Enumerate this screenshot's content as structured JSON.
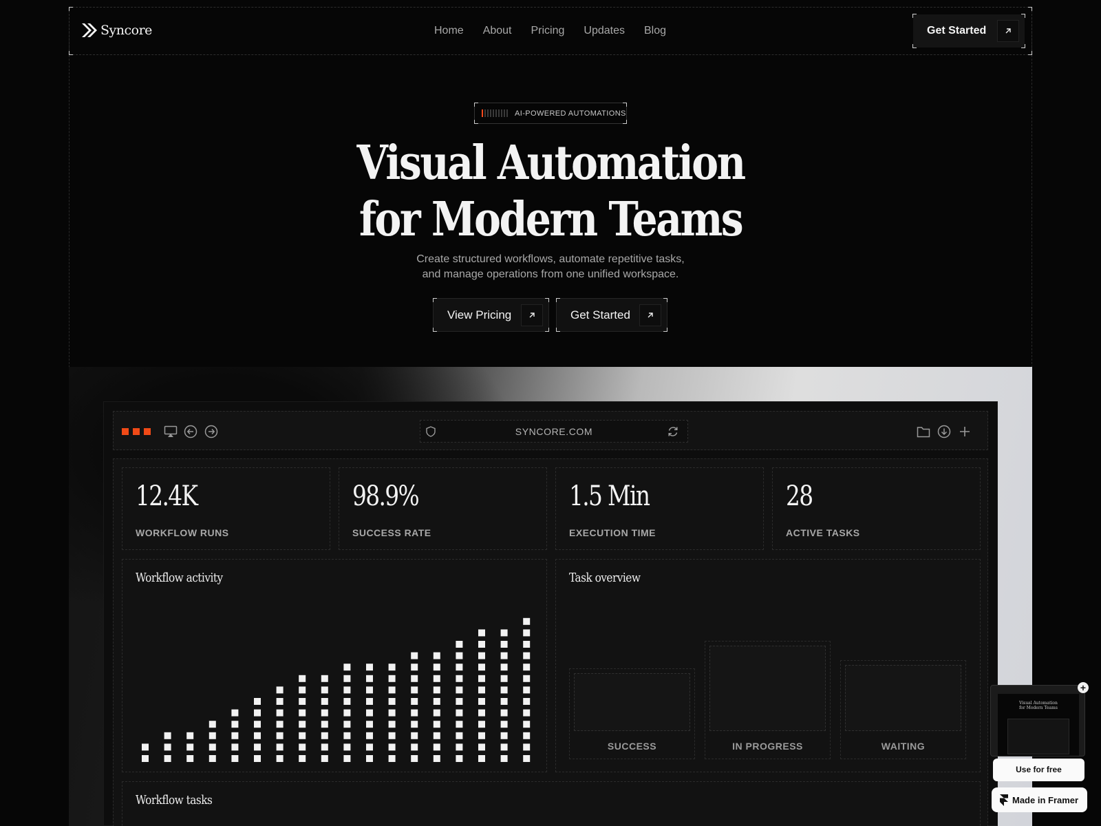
{
  "brand": {
    "name": "Syncore"
  },
  "nav": {
    "links": [
      "Home",
      "About",
      "Pricing",
      "Updates",
      "Blog"
    ],
    "cta_label": "Get Started"
  },
  "hero": {
    "badge": "AI-POWERED AUTOMATIONS",
    "title_line1": "Visual Automation",
    "title_line2": "for Modern Teams",
    "subtitle_line1": "Create structured workflows, automate repetitive tasks,",
    "subtitle_line2": "and manage operations from one unified workspace.",
    "primary_button": "View Pricing",
    "secondary_button": "Get Started"
  },
  "browser": {
    "url": "SYNCORE.COM",
    "traffic_light_color": "#f04a17"
  },
  "stats": [
    {
      "value": "12.4K",
      "label": "WORKFLOW RUNS"
    },
    {
      "value": "98.9%",
      "label": "SUCCESS RATE"
    },
    {
      "value": "1.5 Min",
      "label": "EXECUTION TIME"
    },
    {
      "value": "28",
      "label": "ACTIVE TASKS"
    }
  ],
  "workflow_activity": {
    "title": "Workflow activity",
    "chart_data": {
      "type": "bar",
      "values": [
        2,
        3,
        3,
        4,
        5,
        6,
        7,
        8,
        8,
        9,
        9,
        9,
        10,
        10,
        11,
        12,
        12,
        13
      ]
    }
  },
  "task_overview": {
    "title": "Task overview",
    "items": [
      {
        "label": "SUCCESS"
      },
      {
        "label": "IN PROGRESS"
      },
      {
        "label": "WAITING"
      }
    ]
  },
  "workflow_tasks": {
    "title": "Workflow tasks"
  },
  "framer_badge": {
    "preview_title_line1": "Visual Automation",
    "preview_title_line2": "for Modern Teams",
    "use_label": "Use for free",
    "made_label": "Made in Framer"
  },
  "colors": {
    "accent": "#f04a17",
    "background": "#060606",
    "panel": "#121212"
  }
}
